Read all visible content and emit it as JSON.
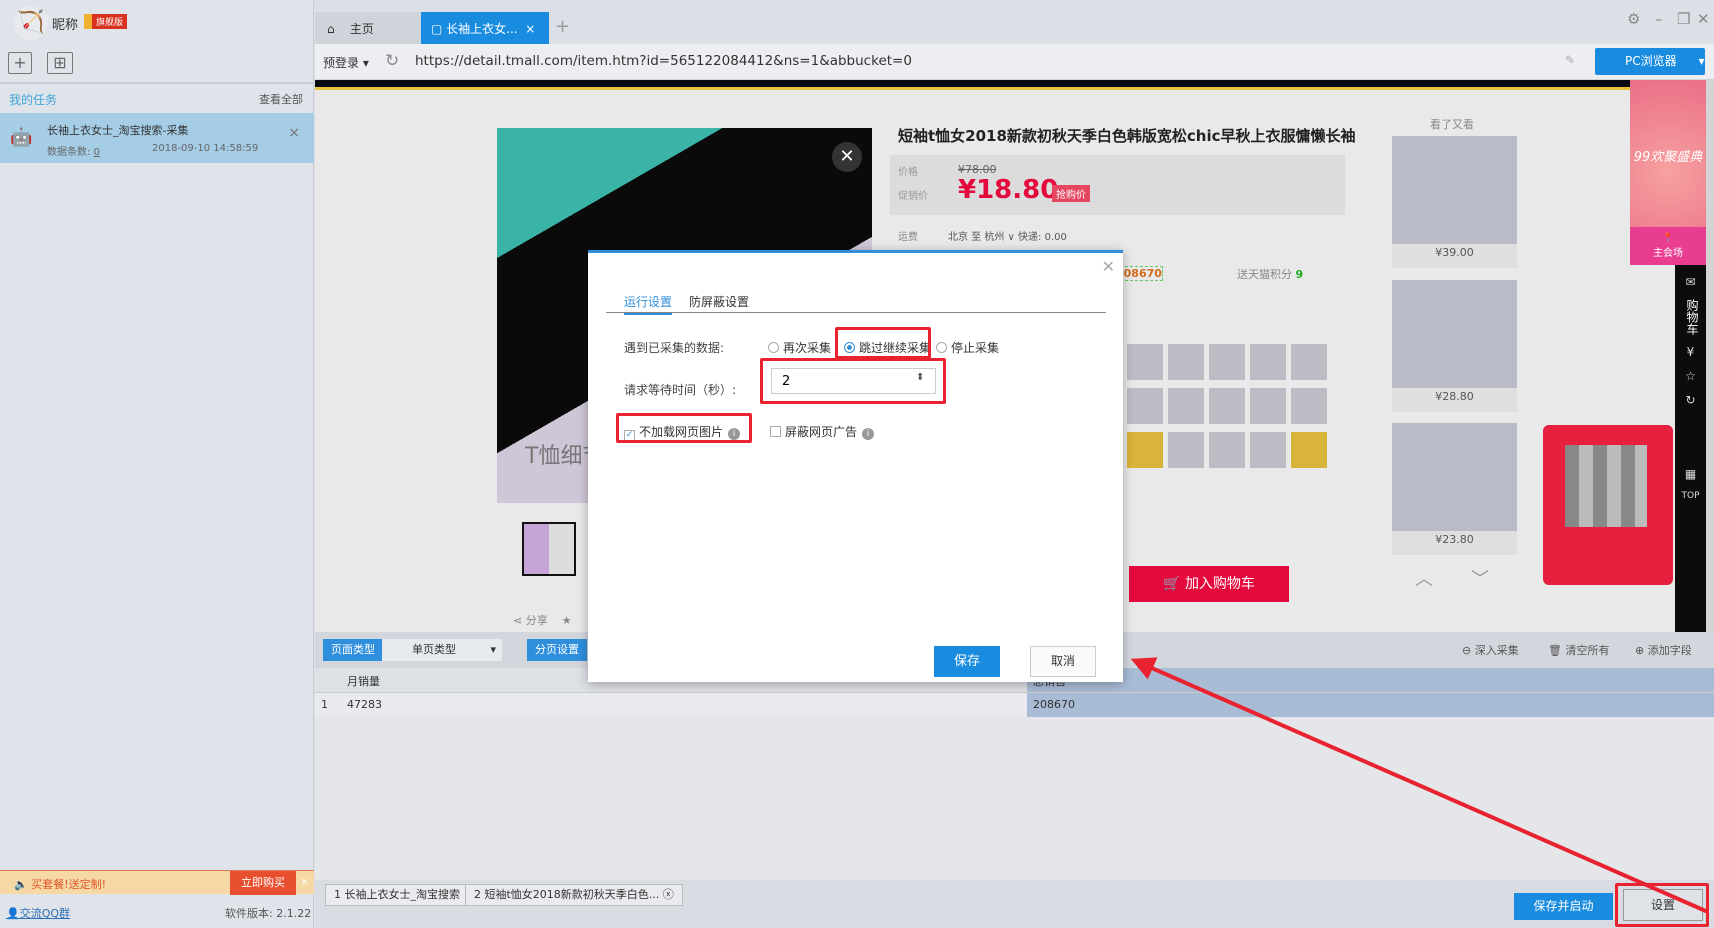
{
  "sidebar": {
    "nickname": "昵称",
    "badge": "旗舰版",
    "my_tasks": "我的任务",
    "view_all": "查看全部",
    "task": {
      "name": "长袖上衣女士_淘宝搜索-采集",
      "meta_label": "数据条数:",
      "meta_value": "0",
      "time": "2018-09-10 14:58:59"
    },
    "promo": {
      "text": "买套餐!送定制!",
      "buy": "立即购买"
    },
    "qq": "交流QQ群",
    "version": "软件版本: 2.1.22"
  },
  "tabs": {
    "home": "主页",
    "active": "长袖上衣女...",
    "close": "×",
    "plus": "+"
  },
  "window": {
    "settings": "⚙",
    "minimize": "–",
    "restore": "❐",
    "close": "✕"
  },
  "address": {
    "login": "预登录 ▾",
    "url": "https://detail.tmall.com/item.htm?id=565122084412&ns=1&abbucket=0",
    "browser": "PC浏览器"
  },
  "product": {
    "caption": "T恤细节",
    "share": "分享",
    "title": "短袖t恤女2018新款初秋天季白色韩版宽松chic早秋上衣服慵懒长袖",
    "price_label": "价格",
    "orig_price": "¥78.00",
    "promo_label": "促销价",
    "price": "¥18.80",
    "price_tag": "抢购价",
    "ship_label": "运费",
    "ship_value": "北京 至 杭州 ∨ 快递: 0.00",
    "sales": "208670",
    "points_label": "送天猫积分",
    "points": "9",
    "add_cart": "加入购物车"
  },
  "recommend": {
    "title": "看了又看",
    "items": [
      {
        "price": "¥39.00"
      },
      {
        "price": "¥28.80"
      },
      {
        "price": "¥23.80"
      }
    ]
  },
  "banner": {
    "text": "99欢聚盛典",
    "foot": "主会场",
    "side": [
      "购物车",
      "¥",
      "☆",
      "TOP"
    ]
  },
  "toolbar": {
    "page_type": "页面类型",
    "page_type_value": "单页类型",
    "pagination": "分页设置",
    "deep": "深入采集",
    "clear": "清空所有",
    "add_field": "添加字段"
  },
  "table": {
    "columns": [
      "月销量",
      "总销售"
    ],
    "rows": [
      {
        "index": "1",
        "cells": [
          "47283",
          "208670"
        ]
      }
    ]
  },
  "jobs": [
    "1 长袖上衣女士_淘宝搜索",
    "2 短袖t恤女2018新款初秋天季白色..."
  ],
  "actions": {
    "save_start": "保存并启动",
    "settings": "设置"
  },
  "dialog": {
    "tabs": [
      "运行设置",
      "防屏蔽设置"
    ],
    "collected_label": "遇到已采集的数据:",
    "options": [
      "再次采集",
      "跳过继续采集",
      "停止采集"
    ],
    "selected_option": "跳过继续采集",
    "wait_label": "请求等待时间（秒）:",
    "wait_value": "2",
    "no_images": {
      "label": "不加载网页图片",
      "checked": true
    },
    "block_ads": {
      "label": "屏蔽网页广告",
      "checked": false
    },
    "save": "保存",
    "cancel": "取消"
  },
  "colors": {
    "accent": "#1a8ce0",
    "highlight": "#e8232f",
    "price": "#e4093d"
  }
}
